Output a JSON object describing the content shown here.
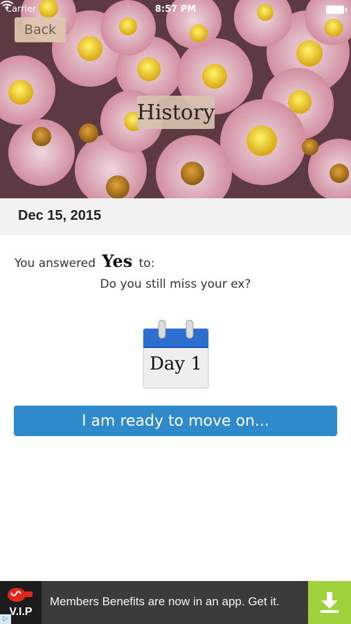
{
  "status_bar": {
    "carrier": "Carrier",
    "time": "8:57 PM"
  },
  "hero": {
    "back_label": "Back",
    "title": "History"
  },
  "entry": {
    "date": "Dec 15, 2015",
    "answered_prefix": "You answered",
    "answer": "Yes",
    "answered_suffix": "to:",
    "question": "Do you still miss your ex?",
    "calendar_day_label": "Day 1"
  },
  "actions": {
    "move_on_label": "I am ready to move on..."
  },
  "ad": {
    "brand_badge": "V.I.P",
    "text": "Members Benefits are now in an app. Get it.",
    "download_icon": "download-arrow-icon",
    "accent_color": "#9fd13a"
  },
  "colors": {
    "primary_button": "#2f8acb",
    "date_bar": "#f2f2f2",
    "ad_background": "#3b3b3b"
  }
}
